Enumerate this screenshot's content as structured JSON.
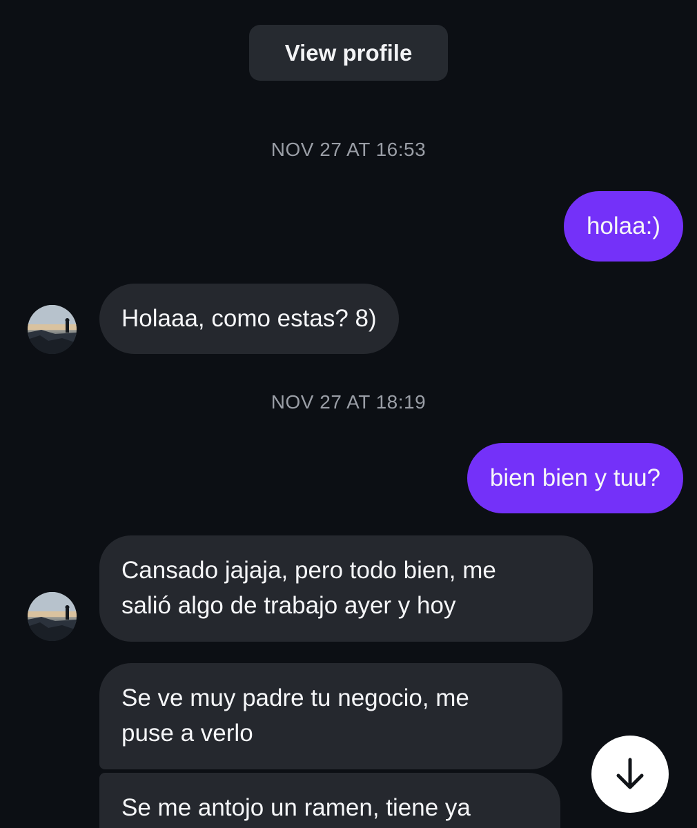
{
  "header": {
    "view_profile_label": "View profile"
  },
  "messages": [
    {
      "type": "timestamp",
      "text": "NOV 27 AT 16:53"
    },
    {
      "type": "outgoing",
      "text": "holaa:)"
    },
    {
      "type": "incoming",
      "text": "Holaaa, como estas? 8)"
    },
    {
      "type": "timestamp",
      "text": "NOV 27 AT 18:19"
    },
    {
      "type": "outgoing",
      "text": "bien bien y tuu?"
    },
    {
      "type": "incoming",
      "line1": "Cansado jajaja, pero todo bien, me",
      "line2": "salió algo de trabajo ayer y hoy"
    },
    {
      "type": "incoming",
      "line1": "Se ve muy padre tu negocio, me",
      "line2": "puse a verlo"
    },
    {
      "type": "incoming",
      "line1": "Se me antojo un ramen, tiene ya"
    }
  ],
  "icons": {
    "contact_avatar": "avatar-photo",
    "scroll_down": "arrow-down-icon"
  },
  "colors": {
    "background": "#0c0f14",
    "outgoing_bubble": "#7431f9",
    "incoming_bubble": "#25282e",
    "timestamp_text": "#9a9ea6"
  }
}
